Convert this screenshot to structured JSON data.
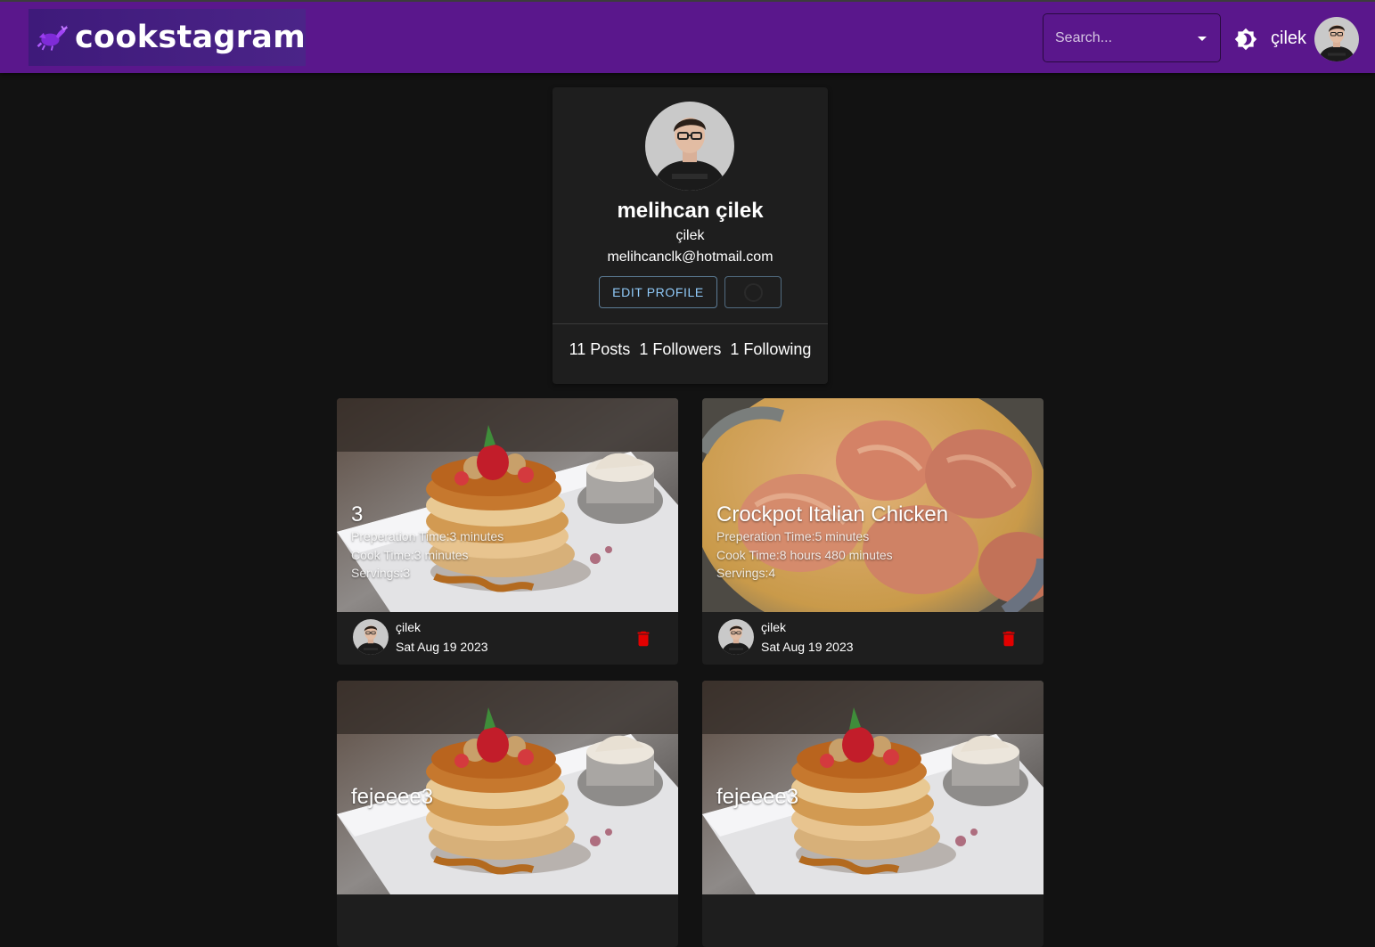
{
  "app": {
    "brand": "cookstagram",
    "search": {
      "placeholder": "Search..."
    },
    "nav_username": "çilek"
  },
  "profile": {
    "name": "melihcan çilek",
    "username": "çilek",
    "email": "melihcanclk@hotmail.com",
    "edit_label": "EDIT PROFILE",
    "stats": {
      "posts": "11 Posts",
      "followers": "1 Followers",
      "following": "1 Following"
    }
  },
  "posts": [
    {
      "title": "3",
      "prep": "Preperation Time:3 minutes",
      "cook": "Cook Time:3 minutes",
      "servings": "Servings:3",
      "author": "çilek",
      "date": "Sat Aug 19 2023"
    },
    {
      "title": "Crockpot Italian Chicken",
      "prep": "Preperation Time:5 minutes",
      "cook": "Cook Time:8 hours 480 minutes",
      "servings": "Servings:4",
      "author": "çilek",
      "date": "Sat Aug 19 2023"
    },
    {
      "title": "fejeeee3"
    },
    {
      "title": "fejeeee3"
    }
  ],
  "colors": {
    "appbar": "#5a178c",
    "background": "#121212",
    "card": "#1e1e1e",
    "accent": "#90caf9",
    "delete": "#e30000"
  },
  "icons": {
    "theme": "brightness-icon",
    "delete": "trash-icon",
    "dropdown": "caret-down-icon"
  }
}
